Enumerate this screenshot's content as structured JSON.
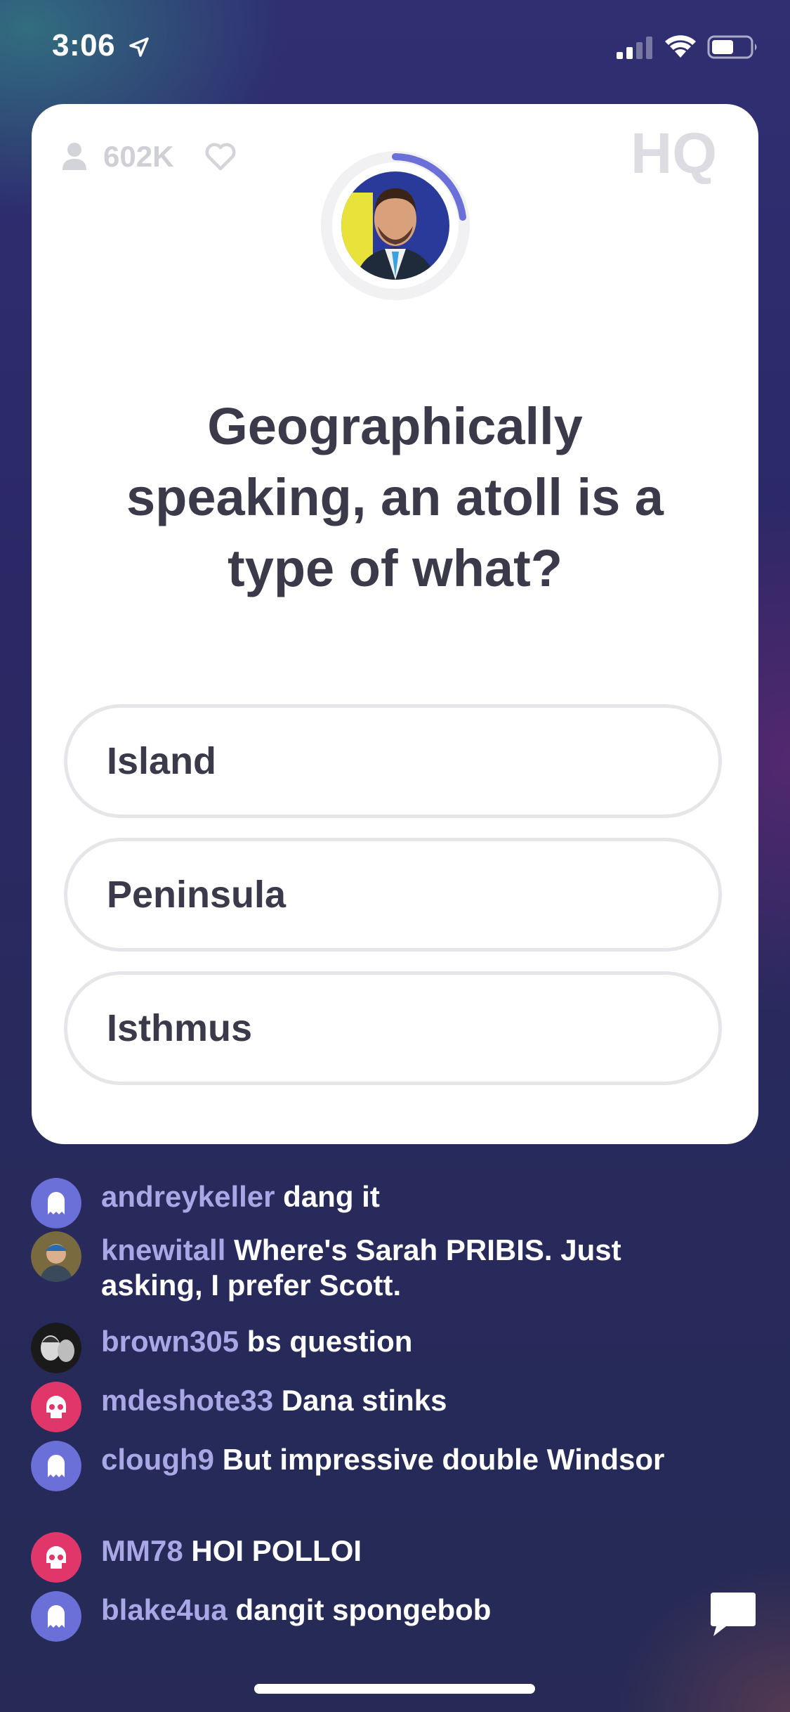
{
  "status_bar": {
    "time": "3:06",
    "icons": [
      "location-arrow-icon",
      "cellular-signal-icon",
      "wifi-icon",
      "battery-icon"
    ]
  },
  "game": {
    "viewer_count": "602K",
    "logo": "HQ",
    "accent_color": "#6b6fd8",
    "question": "Geographically speaking, an atoll is a type of what?",
    "answers": [
      {
        "label": "Island"
      },
      {
        "label": "Peninsula"
      },
      {
        "label": "Isthmus"
      }
    ]
  },
  "chat": {
    "messages": [
      {
        "user": "andreykeller",
        "text": "dang it",
        "avatar": "ghost-purple"
      },
      {
        "user": "knewitall",
        "text": "Where's Sarah PRIBIS.  Just asking, I prefer Scott.",
        "avatar": "photo"
      },
      {
        "user": "brown305",
        "text": "bs question",
        "avatar": "photo-bw"
      },
      {
        "user": "mdeshote33",
        "text": "Dana stinks",
        "avatar": "skull-pink"
      },
      {
        "user": "clough9",
        "text": "But impressive double Windsor",
        "avatar": "ghost-purple"
      },
      {
        "user": "MM78",
        "text": "HOI POLLOI",
        "avatar": "skull-pink"
      },
      {
        "user": "blake4ua",
        "text": "dangit spongebob",
        "avatar": "ghost-purple"
      }
    ]
  }
}
